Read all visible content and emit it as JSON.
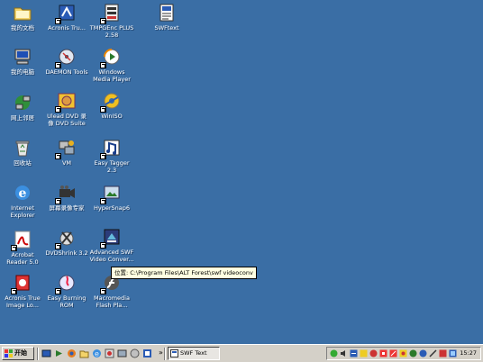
{
  "desktop": {
    "icons": [
      {
        "label": "我的文档"
      },
      {
        "label": "Acronis Tru..."
      },
      {
        "label": "TMPGEnc PLUS 2.58"
      },
      {
        "label": "SWFtext"
      },
      {
        "label": "我的电脑"
      },
      {
        "label": "DAEMON Tools"
      },
      {
        "label": "Windows Media Player"
      },
      {
        "label": "网上邻居"
      },
      {
        "label": "Ulead DVD 录像 DVD Suite"
      },
      {
        "label": "WinISO"
      },
      {
        "label": "回收站"
      },
      {
        "label": "VM"
      },
      {
        "label": "Easy Tagger 2.3"
      },
      {
        "label": "Internet Explorer"
      },
      {
        "label": "屏幕录像专家"
      },
      {
        "label": "HyperSnap6"
      },
      {
        "label": "Acrobat Reader 5.0"
      },
      {
        "label": "DVDShrink 3.2"
      },
      {
        "label": "Advanced SWF Video Conver..."
      },
      {
        "label": "Acronis True Image Lo..."
      },
      {
        "label": "Easy Burning ROM"
      },
      {
        "label": "Macromedia Flash Pla..."
      }
    ]
  },
  "tooltip": {
    "text": "位置: C:\\Program Files\\ALT Forest\\swf videoconv"
  },
  "taskbar": {
    "start_label": "开始",
    "overflow_label": "»",
    "task_label": "SWF Text",
    "clock": "15:27"
  }
}
